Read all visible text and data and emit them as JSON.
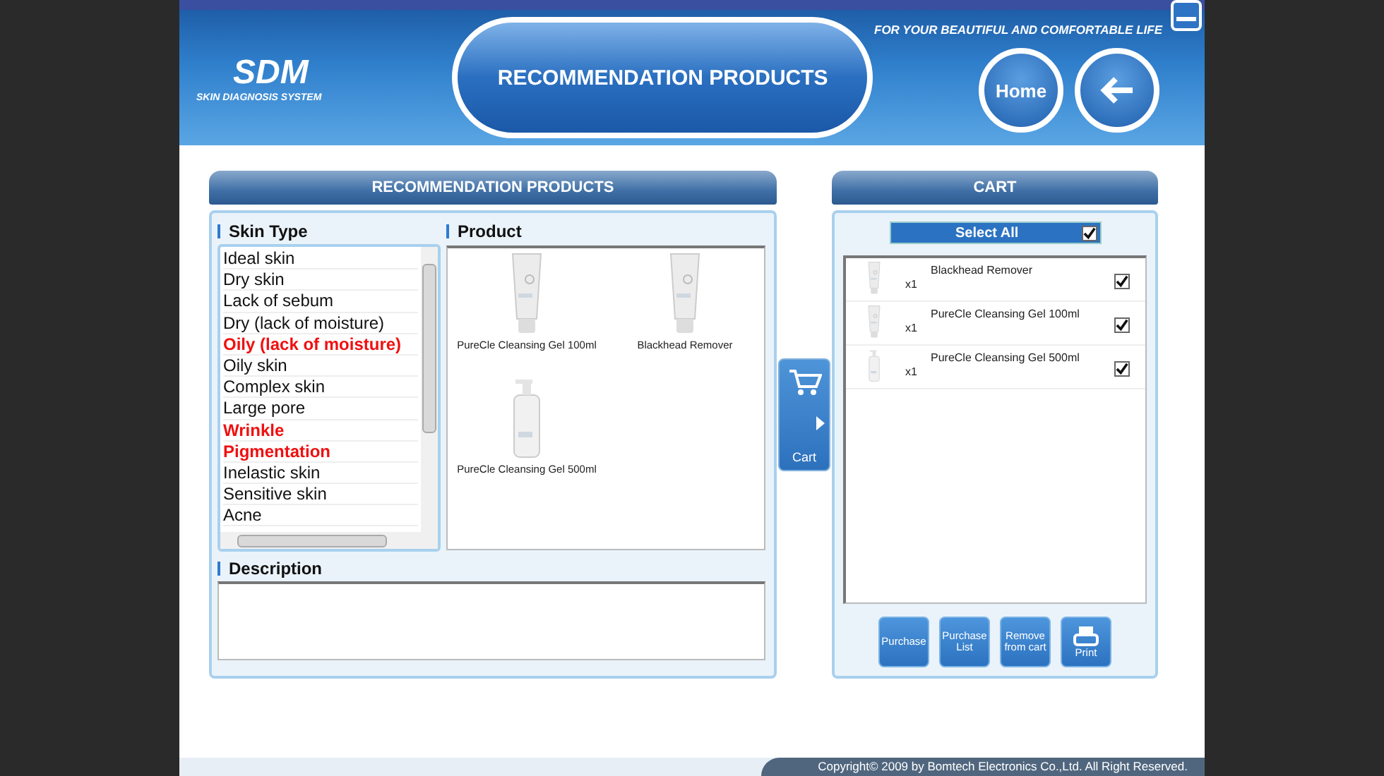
{
  "header": {
    "logo": "SDM",
    "logo_subtitle": "SKIN DIAGNOSIS SYSTEM",
    "tagline": "FOR YOUR BEAUTIFUL AND COMFORTABLE LIFE",
    "title": "RECOMMENDATION PRODUCTS",
    "home_button": "Home"
  },
  "recommendation": {
    "title": "RECOMMENDATION PRODUCTS",
    "skin_type_label": "Skin Type",
    "product_label": "Product",
    "description_label": "Description",
    "skin_types": [
      {
        "label": "Ideal skin",
        "highlighted": false
      },
      {
        "label": "Dry skin",
        "highlighted": false
      },
      {
        "label": "Lack of sebum",
        "highlighted": false
      },
      {
        "label": "Dry (lack of moisture)",
        "highlighted": false
      },
      {
        "label": "Oily (lack of moisture)",
        "highlighted": true
      },
      {
        "label": "Oily skin",
        "highlighted": false
      },
      {
        "label": "Complex skin",
        "highlighted": false
      },
      {
        "label": "Large pore",
        "highlighted": false
      },
      {
        "label": "Wrinkle",
        "highlighted": true
      },
      {
        "label": "Pigmentation",
        "highlighted": true
      },
      {
        "label": "Inelastic skin",
        "highlighted": false
      },
      {
        "label": "Sensitive skin",
        "highlighted": false
      },
      {
        "label": "Acne",
        "highlighted": false
      }
    ],
    "products": [
      {
        "name": "PureCle Cleansing Gel 100ml",
        "kind": "tube"
      },
      {
        "name": "Blackhead Remover",
        "kind": "tube"
      },
      {
        "name": "PureCle Cleansing Gel 500ml",
        "kind": "pump"
      }
    ]
  },
  "cart_tab": {
    "label": "Cart"
  },
  "cart": {
    "title": "CART",
    "select_all": {
      "label": "Select All",
      "checked": true
    },
    "items": [
      {
        "name": "Blackhead Remover",
        "quantity": "x1",
        "kind": "tube",
        "checked": true
      },
      {
        "name": "PureCle Cleansing Gel 100ml",
        "quantity": "x1",
        "kind": "tube",
        "checked": true
      },
      {
        "name": "PureCle Cleansing Gel 500ml",
        "quantity": "x1",
        "kind": "pump",
        "checked": true
      }
    ],
    "buttons": [
      {
        "label": "Purchase",
        "kind": "text"
      },
      {
        "label": "Purchase List",
        "kind": "text"
      },
      {
        "label": "Remove from cart",
        "kind": "text"
      },
      {
        "label": "Print",
        "kind": "print"
      }
    ]
  },
  "footer": {
    "copyright": "Copyright© 2009 by Bomtech Electronics Co.,Ltd.  All Right Reserved."
  }
}
